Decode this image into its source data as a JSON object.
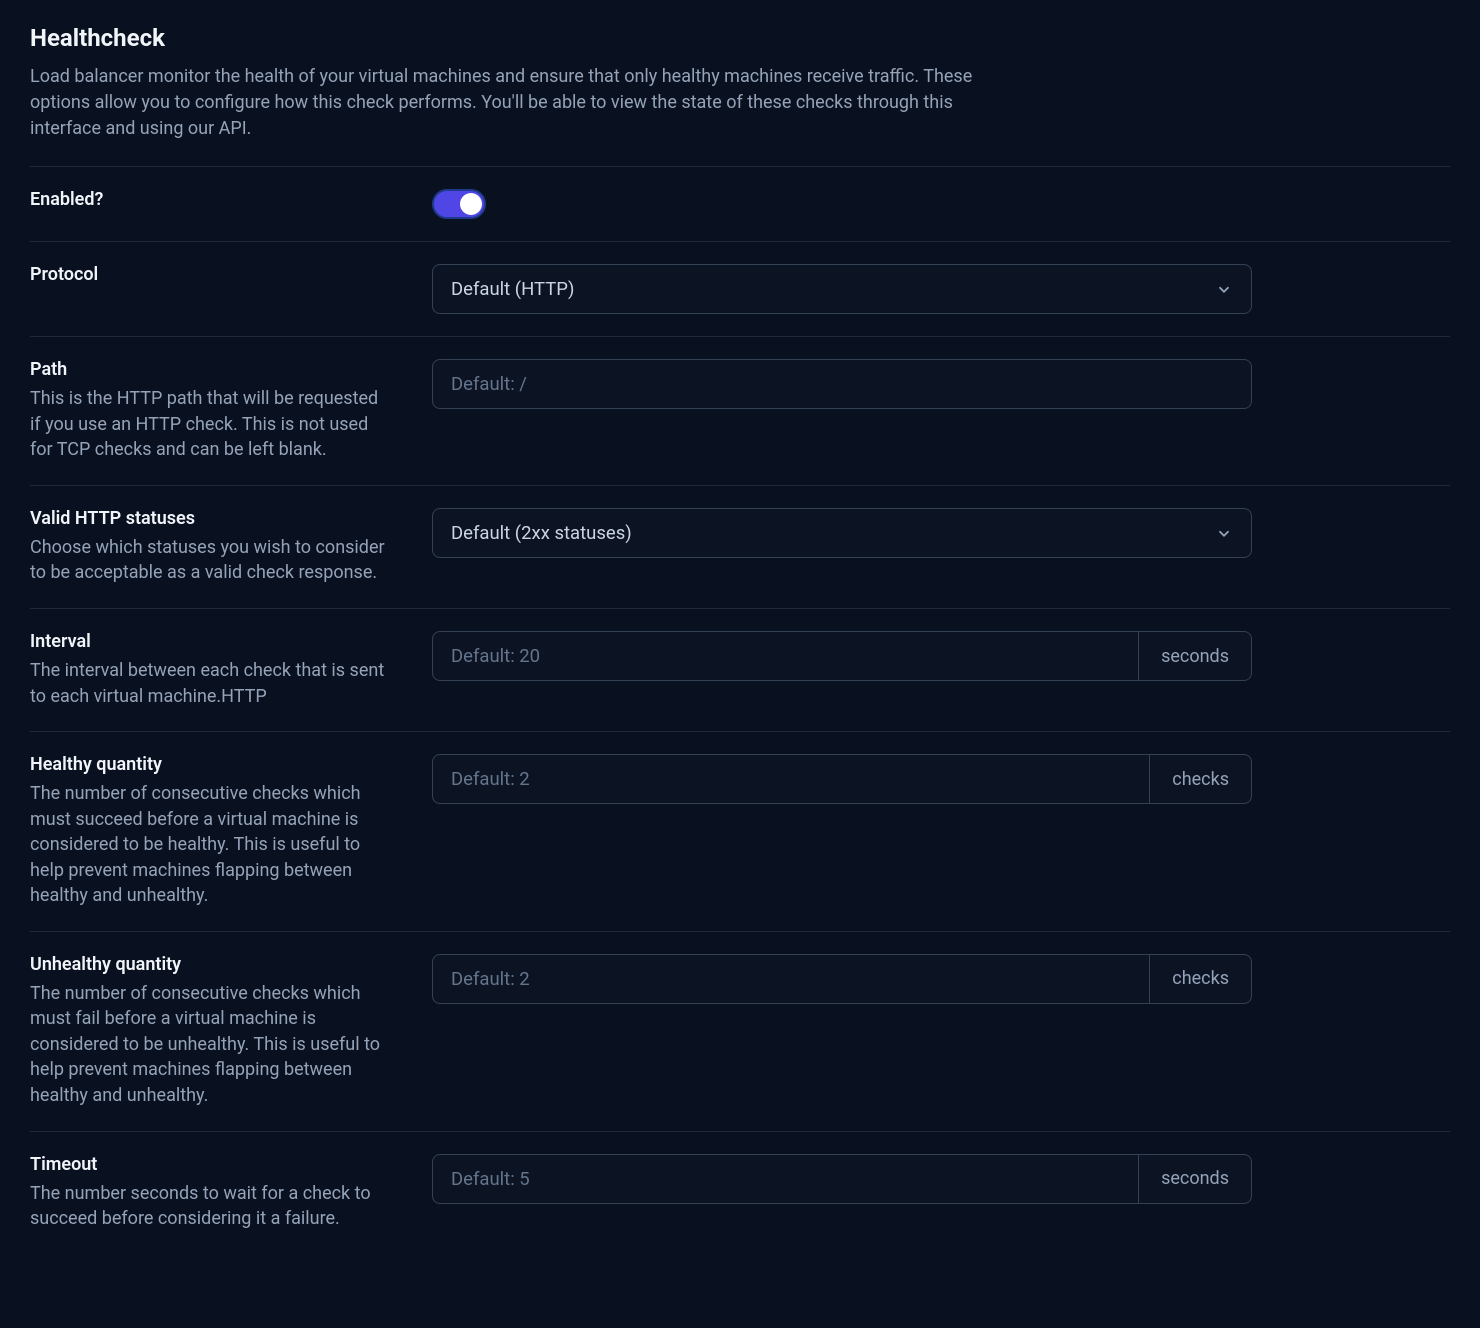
{
  "header": {
    "title": "Healthcheck",
    "description": "Load balancer monitor the health of your virtual machines and ensure that only healthy machines receive traffic. These options allow you to configure how this check performs. You'll be able to view the state of these checks through this interface and using our API."
  },
  "enabled": {
    "label": "Enabled?",
    "value": true
  },
  "protocol": {
    "label": "Protocol",
    "selected": "Default (HTTP)"
  },
  "path": {
    "label": "Path",
    "description": "This is the HTTP path that will be requested if you use an HTTP check. This is not used for TCP checks and can be left blank.",
    "placeholder": "Default: /"
  },
  "statuses": {
    "label": "Valid HTTP statuses",
    "description": "Choose which statuses you wish to consider to be acceptable as a valid check response.",
    "selected": "Default (2xx statuses)"
  },
  "interval": {
    "label": "Interval",
    "description": "The interval between each check that is sent to each virtual machine.HTTP",
    "placeholder": "Default: 20",
    "unit": "seconds"
  },
  "healthy": {
    "label": "Healthy quantity",
    "description": "The number of consecutive checks which must succeed before a virtual machine is considered to be healthy. This is useful to help prevent machines flapping between healthy and unhealthy.",
    "placeholder": "Default: 2",
    "unit": "checks"
  },
  "unhealthy": {
    "label": "Unhealthy quantity",
    "description": "The number of consecutive checks which must fail before a virtual machine is considered to be unhealthy. This is useful to help prevent machines flapping between healthy and unhealthy.",
    "placeholder": "Default: 2",
    "unit": "checks"
  },
  "timeout": {
    "label": "Timeout",
    "description": "The number seconds to wait for a check to succeed before considering it a failure.",
    "placeholder": "Default: 5",
    "unit": "seconds"
  }
}
